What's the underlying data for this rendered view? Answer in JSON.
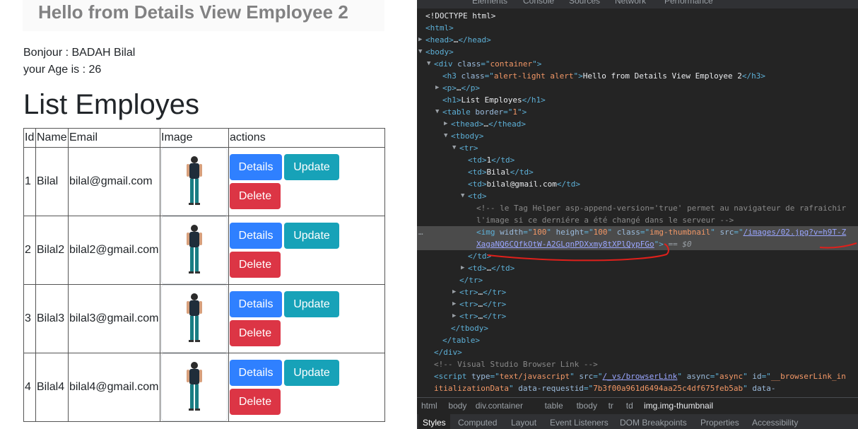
{
  "page": {
    "alert_heading": "Hello from Details View Employee 2",
    "greeting": "Bonjour : BADAH Bilal",
    "age_text": "your Age is : 26",
    "list_title": "List Employes",
    "table_headers": [
      "Id",
      "Name",
      "Email",
      "Image",
      "actions"
    ],
    "buttons": {
      "details": "Details",
      "update": "Update",
      "delete": "Delete"
    },
    "employees": [
      {
        "id": "1",
        "name": "Bilal",
        "email": "bilal@gmail.com"
      },
      {
        "id": "2",
        "name": "Bilal2",
        "email": "bilal2@gmail.com"
      },
      {
        "id": "3",
        "name": "Bilal3",
        "email": "bilal3@gmail.com"
      },
      {
        "id": "4",
        "name": "Bilal4",
        "email": "bilal4@gmail.com"
      }
    ]
  },
  "devtools": {
    "tabs": [
      "Elements",
      "Console",
      "Sources",
      "Network",
      "Performance"
    ],
    "lines": [
      {
        "indent": 0,
        "html": "<span class='txt'>&lt;!DOCTYPE html&gt;</span>"
      },
      {
        "indent": 0,
        "html": "<span class='tag'>&lt;html&gt;</span>"
      },
      {
        "indent": 0,
        "tri": "▶",
        "html": "<span class='tag'>&lt;head&gt;</span><span class='txt'>…</span><span class='tag'>&lt;/head&gt;</span>"
      },
      {
        "indent": 0,
        "tri": "▼",
        "html": "<span class='tag'>&lt;body&gt;</span>"
      },
      {
        "indent": 1,
        "tri": "▼",
        "html": "<span class='tag'>&lt;div </span><span class='attr'>class</span><span class='tag'>=\"</span><span class='val'>container</span><span class='tag'>\"&gt;</span>"
      },
      {
        "indent": 2,
        "html": "<span class='tag'>&lt;h3 </span><span class='attr'>class</span><span class='tag'>=\"</span><span class='val'>alert-light alert</span><span class='tag'>\"&gt;</span><span class='txt'>Hello from Details View Employee 2</span><span class='tag'>&lt;/h3&gt;</span>"
      },
      {
        "indent": 2,
        "tri": "▶",
        "html": "<span class='tag'>&lt;p&gt;</span><span class='txt'>…</span><span class='tag'>&lt;/p&gt;</span>"
      },
      {
        "indent": 2,
        "html": "<span class='tag'>&lt;h1&gt;</span><span class='txt'>List Employes</span><span class='tag'>&lt;/h1&gt;</span>"
      },
      {
        "indent": 2,
        "tri": "▼",
        "html": "<span class='tag'>&lt;table </span><span class='attr'>border</span><span class='tag'>=\"</span><span class='val'>1</span><span class='tag'>\"&gt;</span>"
      },
      {
        "indent": 3,
        "tri": "▶",
        "html": "<span class='tag'>&lt;thead&gt;</span><span class='txt'>…</span><span class='tag'>&lt;/thead&gt;</span>"
      },
      {
        "indent": 3,
        "tri": "▼",
        "html": "<span class='tag'>&lt;tbody&gt;</span>"
      },
      {
        "indent": 4,
        "tri": "▼",
        "html": "<span class='tag'>&lt;tr&gt;</span>"
      },
      {
        "indent": 5,
        "html": "<span class='tag'>&lt;td&gt;</span><span class='txt'>1</span><span class='tag'>&lt;/td&gt;</span>"
      },
      {
        "indent": 5,
        "html": "<span class='tag'>&lt;td&gt;</span><span class='txt'>Bilal</span><span class='tag'>&lt;/td&gt;</span>"
      },
      {
        "indent": 5,
        "html": "<span class='tag'>&lt;td&gt;</span><span class='txt'>bilal@gmail.com</span><span class='tag'>&lt;/td&gt;</span>"
      },
      {
        "indent": 5,
        "tri": "▼",
        "html": "<span class='tag'>&lt;td&gt;</span>"
      },
      {
        "indent": 6,
        "html": "<span class='cmt'>&lt;!-- le Tag Helper asp-append-version='true' permet au navigateur de rafraichir</span>"
      },
      {
        "indent": 6,
        "html": "<span class='cmt'>l'image si ce derniére a été changé dans le serveur  --&gt;</span>"
      },
      {
        "indent": 6,
        "selected": true,
        "html": "<span class='tag'>&lt;img </span><span class='attr'>width</span><span class='tag'>=\"</span><span class='val'>100</span><span class='tag'>\" </span><span class='attr'>height</span><span class='tag'>=\"</span><span class='val'>100</span><span class='tag'>\" </span><span class='attr'>class</span><span class='tag'>=\"</span><span class='val'>img-thumbnail</span><span class='tag'>\" </span><span class='attr'>src</span><span class='tag'>=\"</span><span class='link'>/images/02.jpg?v=h9T-Z</span>"
      },
      {
        "indent": 6,
        "selected": true,
        "html": "<span class='link'>XagaNQ6CQfkOtW-A2GLqnPDXxmy8tXPlQypFGo</span><span class='tag'>\"&gt;</span><span class='dim'> == </span><span class='dim' style='font-style:italic'>$0</span>"
      },
      {
        "indent": 5,
        "html": "<span class='tag'>&lt;/td&gt;</span>"
      },
      {
        "indent": 5,
        "tri": "▶",
        "html": "<span class='tag'>&lt;td&gt;</span><span class='txt'>…</span><span class='tag'>&lt;/td&gt;</span>"
      },
      {
        "indent": 4,
        "html": "<span class='tag'>&lt;/tr&gt;</span>"
      },
      {
        "indent": 4,
        "tri": "▶",
        "html": "<span class='tag'>&lt;tr&gt;</span><span class='txt'>…</span><span class='tag'>&lt;/tr&gt;</span>"
      },
      {
        "indent": 4,
        "tri": "▶",
        "html": "<span class='tag'>&lt;tr&gt;</span><span class='txt'>…</span><span class='tag'>&lt;/tr&gt;</span>"
      },
      {
        "indent": 4,
        "tri": "▶",
        "html": "<span class='tag'>&lt;tr&gt;</span><span class='txt'>…</span><span class='tag'>&lt;/tr&gt;</span>"
      },
      {
        "indent": 3,
        "html": "<span class='tag'>&lt;/tbody&gt;</span>"
      },
      {
        "indent": 2,
        "html": "<span class='tag'>&lt;/table&gt;</span>"
      },
      {
        "indent": 1,
        "html": "<span class='tag'>&lt;/div&gt;</span>"
      },
      {
        "indent": 1,
        "html": "<span class='cmt'>&lt;!-- Visual Studio Browser Link --&gt;</span>"
      },
      {
        "indent": 1,
        "html": "<span class='tag'>&lt;script </span><span class='attr'>type</span><span class='tag'>=\"</span><span class='val'>text/javascript</span><span class='tag'>\" </span><span class='attr'>src</span><span class='tag'>=\"</span><span class='link'>/_vs/browserLink</span><span class='tag'>\" </span><span class='attr'>async</span><span class='tag'>=\"</span><span class='val'>async</span><span class='tag'>\" </span><span class='attr'>id</span><span class='tag'>=\"</span><span class='val'>__browserLink_in</span>"
      },
      {
        "indent": 1,
        "html": "<span class='val'>itializationData</span><span class='tag'>\" </span><span class='attr'>data-requestid</span><span class='tag'>=\"</span><span class='val'>7b3f00a961d6494aa25c4df675feb5ab</span><span class='tag'>\" </span><span class='attr'>data-</span>"
      }
    ],
    "breadcrumb": [
      "html",
      "body",
      "div.container",
      "table",
      "tbody",
      "tr",
      "td",
      "img.img-thumbnail"
    ],
    "bottom_tabs": [
      "Styles",
      "Computed",
      "Layout",
      "Event Listeners",
      "DOM Breakpoints",
      "Properties",
      "Accessibility"
    ]
  }
}
